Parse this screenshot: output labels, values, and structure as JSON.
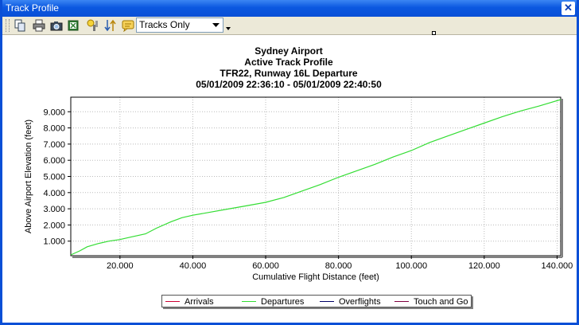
{
  "window": {
    "title": "Track Profile",
    "close_glyph": "✕"
  },
  "toolbar": {
    "icons": [
      "copy-icon",
      "print-icon",
      "camera-icon",
      "export-icon",
      "settings-icon",
      "sort-icon",
      "comment-icon"
    ],
    "filter_value": "Tracks Only"
  },
  "chart_data": {
    "type": "line",
    "title_lines": [
      "Sydney Airport",
      "Active Track Profile",
      "TFR22, Runway 16L Departure",
      "05/01/2009 22:36:10 - 05/01/2009 22:40:50"
    ],
    "xlabel": "Cumulative Flight Distance (feet)",
    "ylabel": "Above Airport Elevation (feet)",
    "xlim": [
      6500,
      141000
    ],
    "ylim": [
      100,
      9900
    ],
    "x_ticks": [
      20000,
      40000,
      60000,
      80000,
      100000,
      120000,
      140000
    ],
    "x_tick_labels": [
      "20.000",
      "40.000",
      "60.000",
      "80.000",
      "100.000",
      "120.000",
      "140.000"
    ],
    "y_ticks": [
      1000,
      2000,
      3000,
      4000,
      5000,
      6000,
      7000,
      8000,
      9000
    ],
    "y_tick_labels": [
      "1.000",
      "2.000",
      "3.000",
      "4.000",
      "5.000",
      "6.000",
      "7.000",
      "8.000",
      "9.000"
    ],
    "grid": true,
    "legend_position": "bottom",
    "series": [
      {
        "name": "Arrivals",
        "color": "#cc0033",
        "x": [],
        "y": []
      },
      {
        "name": "Departures",
        "color": "#33dd33",
        "x": [
          6500,
          9000,
          11000,
          14000,
          17000,
          20000,
          23000,
          27000,
          30000,
          34000,
          37000,
          40000,
          45000,
          50000,
          55000,
          60000,
          65000,
          70000,
          75000,
          80000,
          85000,
          90000,
          95000,
          100000,
          105000,
          110000,
          115000,
          120000,
          125000,
          130000,
          135000,
          141000
        ],
        "y": [
          150,
          400,
          650,
          850,
          1000,
          1100,
          1250,
          1450,
          1800,
          2200,
          2450,
          2600,
          2800,
          3000,
          3200,
          3400,
          3700,
          4100,
          4500,
          4950,
          5350,
          5750,
          6200,
          6600,
          7100,
          7500,
          7900,
          8300,
          8700,
          9050,
          9350,
          9750
        ]
      },
      {
        "name": "Overflights",
        "color": "#000066",
        "x": [],
        "y": []
      },
      {
        "name": "Touch and Go",
        "color": "#800040",
        "x": [],
        "y": []
      }
    ]
  }
}
